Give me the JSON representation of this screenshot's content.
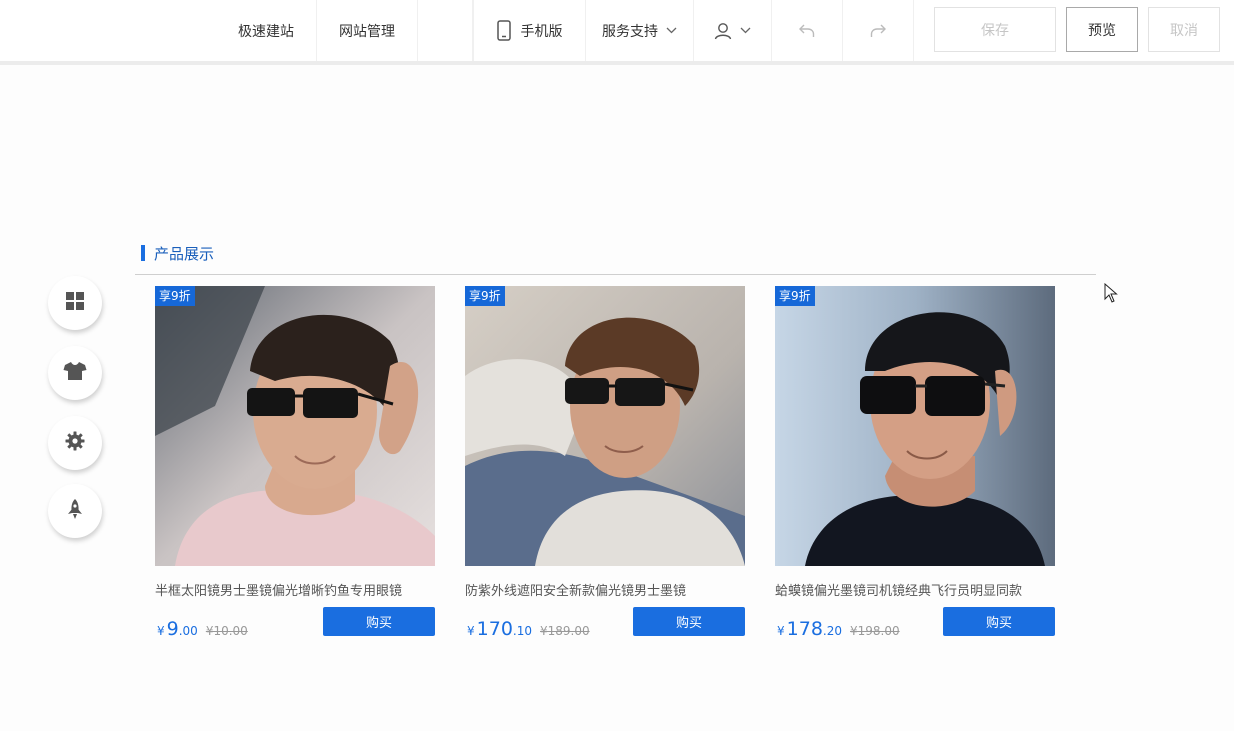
{
  "toolbar": {
    "quick_build": "极速建站",
    "site_manage": "网站管理",
    "mobile": "手机版",
    "service": "服务支持",
    "save": "保存",
    "preview": "预览",
    "cancel": "取消"
  },
  "sidebar_icons": [
    "grid-icon",
    "tshirt-icon",
    "gear-icon",
    "rocket-icon"
  ],
  "section": {
    "title": "产品展示"
  },
  "colors": {
    "accent": "#1a6ee0",
    "badge": "#1668d8"
  },
  "products": [
    {
      "badge": "享9折",
      "name": "半框太阳镜男士墨镜偏光增晰钓鱼专用眼镜",
      "currency": "¥",
      "price_int": "9",
      "price_dec": ".00",
      "original": "¥10.00",
      "buy": "购买"
    },
    {
      "badge": "享9折",
      "name": "防紫外线遮阳安全新款偏光镜男士墨镜",
      "currency": "¥",
      "price_int": "170",
      "price_dec": ".10",
      "original": "¥189.00",
      "buy": "购买"
    },
    {
      "badge": "享9折",
      "name": "蛤蟆镜偏光墨镜司机镜经典飞行员明显同款",
      "currency": "¥",
      "price_int": "178",
      "price_dec": ".20",
      "original": "¥198.00",
      "buy": "购买"
    }
  ]
}
